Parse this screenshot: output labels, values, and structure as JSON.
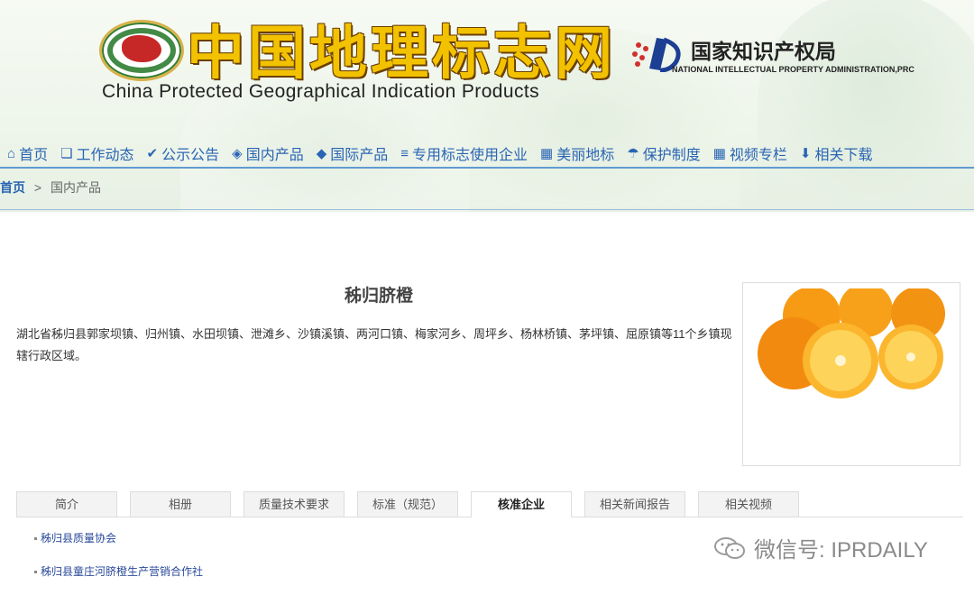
{
  "header": {
    "title_cn": "中国地理标志网",
    "title_en": "China Protected Geographical Indication Products",
    "agency_cn": "国家知识产权局",
    "agency_en": "NATIONAL INTELLECTUAL PROPERTY ADMINISTRATION,PRC"
  },
  "nav": {
    "items": [
      {
        "label": "首页",
        "icon": "home-icon"
      },
      {
        "label": "工作动态",
        "icon": "bookmark-icon"
      },
      {
        "label": "公示公告",
        "icon": "check-circle-icon"
      },
      {
        "label": "国内产品",
        "icon": "tag-icon"
      },
      {
        "label": "国际产品",
        "icon": "tag-icon"
      },
      {
        "label": "专用标志使用企业",
        "icon": "list-icon"
      },
      {
        "label": "美丽地标",
        "icon": "calendar-icon"
      },
      {
        "label": "保护制度",
        "icon": "umbrella-icon"
      },
      {
        "label": "视频专栏",
        "icon": "calendar-icon"
      },
      {
        "label": "相关下载",
        "icon": "arrow-down-icon"
      }
    ]
  },
  "breadcrumb": {
    "home": "首页",
    "sep": ">",
    "current": "国内产品"
  },
  "product": {
    "name": "秭归脐橙",
    "description": "湖北省秭归县郭家坝镇、归州镇、水田坝镇、泄滩乡、沙镇溪镇、两河口镇、梅家河乡、周坪乡、杨林桥镇、茅坪镇、屈原镇等11个乡镇现辖行政区域。"
  },
  "tabs": [
    "简介",
    "相册",
    "质量技术要求",
    "标准（规范）",
    "核准企业",
    "相关新闻报告",
    "相关视频"
  ],
  "active_tab": "核准企业",
  "enterprises": [
    "秭归县质量协会",
    "秭归县童庄河脐橙生产营销合作社"
  ],
  "watermark": "微信号: IPRDAILY",
  "colors": {
    "accent": "#2a65b3",
    "title_gold": "#f2c200"
  }
}
